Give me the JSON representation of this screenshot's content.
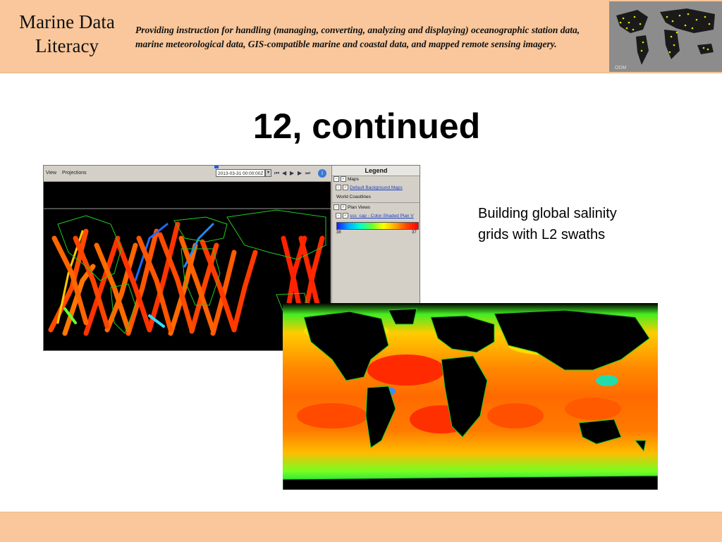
{
  "header": {
    "logo_line1": "Marine Data",
    "logo_line2": "Literacy",
    "tagline": "Providing instruction for handling (managing, converting, analyzing and displaying) oceanographic station data, marine meteorological data, GIS-compatible marine and coastal data, and mapped remote sensing imagery."
  },
  "slide": {
    "title": "12, continued",
    "caption": "Building global salinity grids with L2 swaths"
  },
  "app": {
    "menu": [
      "View",
      "Projections"
    ],
    "date_value": "2013-03-31 00:00:00Z",
    "legend": {
      "title": "Legend",
      "items": [
        {
          "label": "Maps",
          "link": false
        },
        {
          "label": "Default Background Maps",
          "link": true
        },
        {
          "label": "World Coastlines",
          "link": false
        },
        {
          "label": "Plan Views",
          "link": false
        },
        {
          "label": "sss_cap - Color-Shaded Plan V",
          "link": true
        }
      ],
      "scale_min": "38",
      "scale_max": "37"
    }
  },
  "colors": {
    "banner": "#f9c79b",
    "land": "#000000",
    "coast": "#22cc22"
  }
}
